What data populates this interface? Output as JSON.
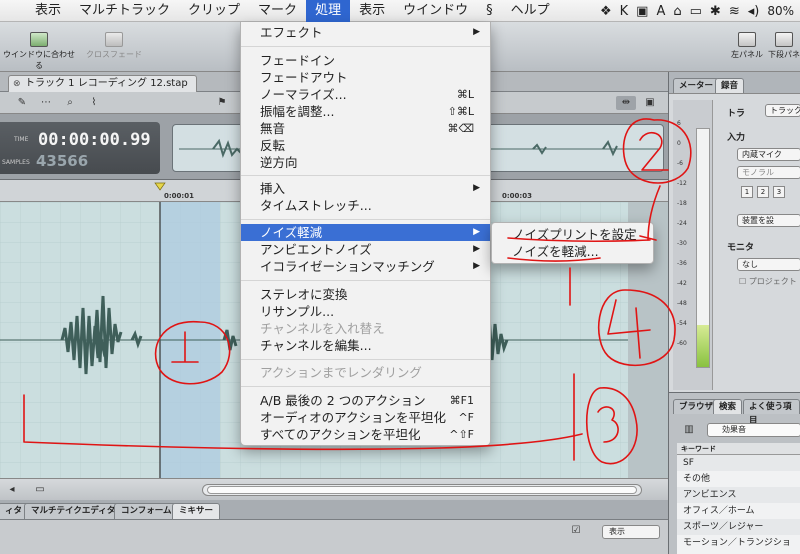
{
  "menubar": {
    "items": [
      "表示",
      "マルチトラック",
      "クリップ",
      "マーク",
      "処理",
      "表示",
      "ウインドウ",
      "ヘルプ"
    ],
    "active": "処理",
    "battery": "80%"
  },
  "toolbar": {
    "fit_window": "ウインドウに合わせる",
    "crossfade": "クロスフェード",
    "left_panel": "左パネル",
    "bottom_panel": "下段パネ"
  },
  "document": {
    "tab": "トラック 1 レコーディング 12.stap",
    "time_label": "TIME",
    "time": "00:00:00.99",
    "samples_label": "SAMPLES",
    "samples": "43566"
  },
  "ruler": {
    "ticks": [
      "0:00:01",
      "0:00:03"
    ]
  },
  "menu": {
    "effects": "エフェクト",
    "fade_in": "フェードイン",
    "fade_out": "フェードアウト",
    "normalize": "ノーマライズ...",
    "normalize_sc": "⌘L",
    "amplitude": "振幅を調整...",
    "amplitude_sc": "⇧⌘L",
    "silence": "無音",
    "silence_sc": "⌘⌫",
    "invert": "反転",
    "reverse": "逆方向",
    "insert": "挿入",
    "time_stretch": "タイムストレッチ...",
    "noise_reduction": "ノイズ軽減",
    "ambient_noise": "アンビエントノイズ",
    "eq_matching": "イコライゼーションマッチング",
    "to_stereo": "ステレオに変換",
    "resample": "リサンプル...",
    "swap_channels": "チャンネルを入れ替え",
    "edit_channels": "チャンネルを編集...",
    "render_actions": "アクションまでレンダリング",
    "ab_last": "A/B 最後の 2 つのアクション",
    "ab_last_sc": "⌘F1",
    "flatten_audio": "オーディオのアクションを平坦化",
    "flatten_audio_sc": "^F",
    "flatten_all": "すべてのアクションを平坦化",
    "flatten_all_sc": "^⇧F"
  },
  "submenu": {
    "set_print": "ノイズプリントを設定",
    "reduce": "ノイズを軽減..."
  },
  "right_panel": {
    "tab_meter": "メーター",
    "tab_record": "録音",
    "track_label": "トラ",
    "track_value": "トラック",
    "input_label": "入力",
    "input_value": "内蔵マイク",
    "mono": "モノラル",
    "ch1": "1",
    "ch2": "2",
    "ch3": "3",
    "device_settings": "装置を設",
    "monitor_label": "モニタ",
    "monitor_value": "なし",
    "project": "プロジェクト",
    "meter_scale": [
      "6",
      "0",
      "-6",
      "-12",
      "-18",
      "-24",
      "-30",
      "-36",
      "-42",
      "-48",
      "-54",
      "-60"
    ]
  },
  "browser_panel": {
    "tab_browser": "ブラウザ",
    "tab_search": "検索",
    "tab_frequent": "よく使う項目",
    "search_value": "効果音",
    "keyword_header": "キーワード",
    "keywords": [
      "SF",
      "その他",
      "アンビエンス",
      "オフィス／ホーム",
      "スポーツ／レジャー",
      "モーション／トランジショ"
    ]
  },
  "bottom_tabs": [
    "ィタ",
    "マルチテイクエディタ",
    "コンフォーム",
    "ミキサー"
  ],
  "bottom": {
    "display": "表示"
  },
  "colors": {
    "accent": "#3a6fd4",
    "annotation": "#e01414",
    "waveform": "#3f5f5a"
  }
}
